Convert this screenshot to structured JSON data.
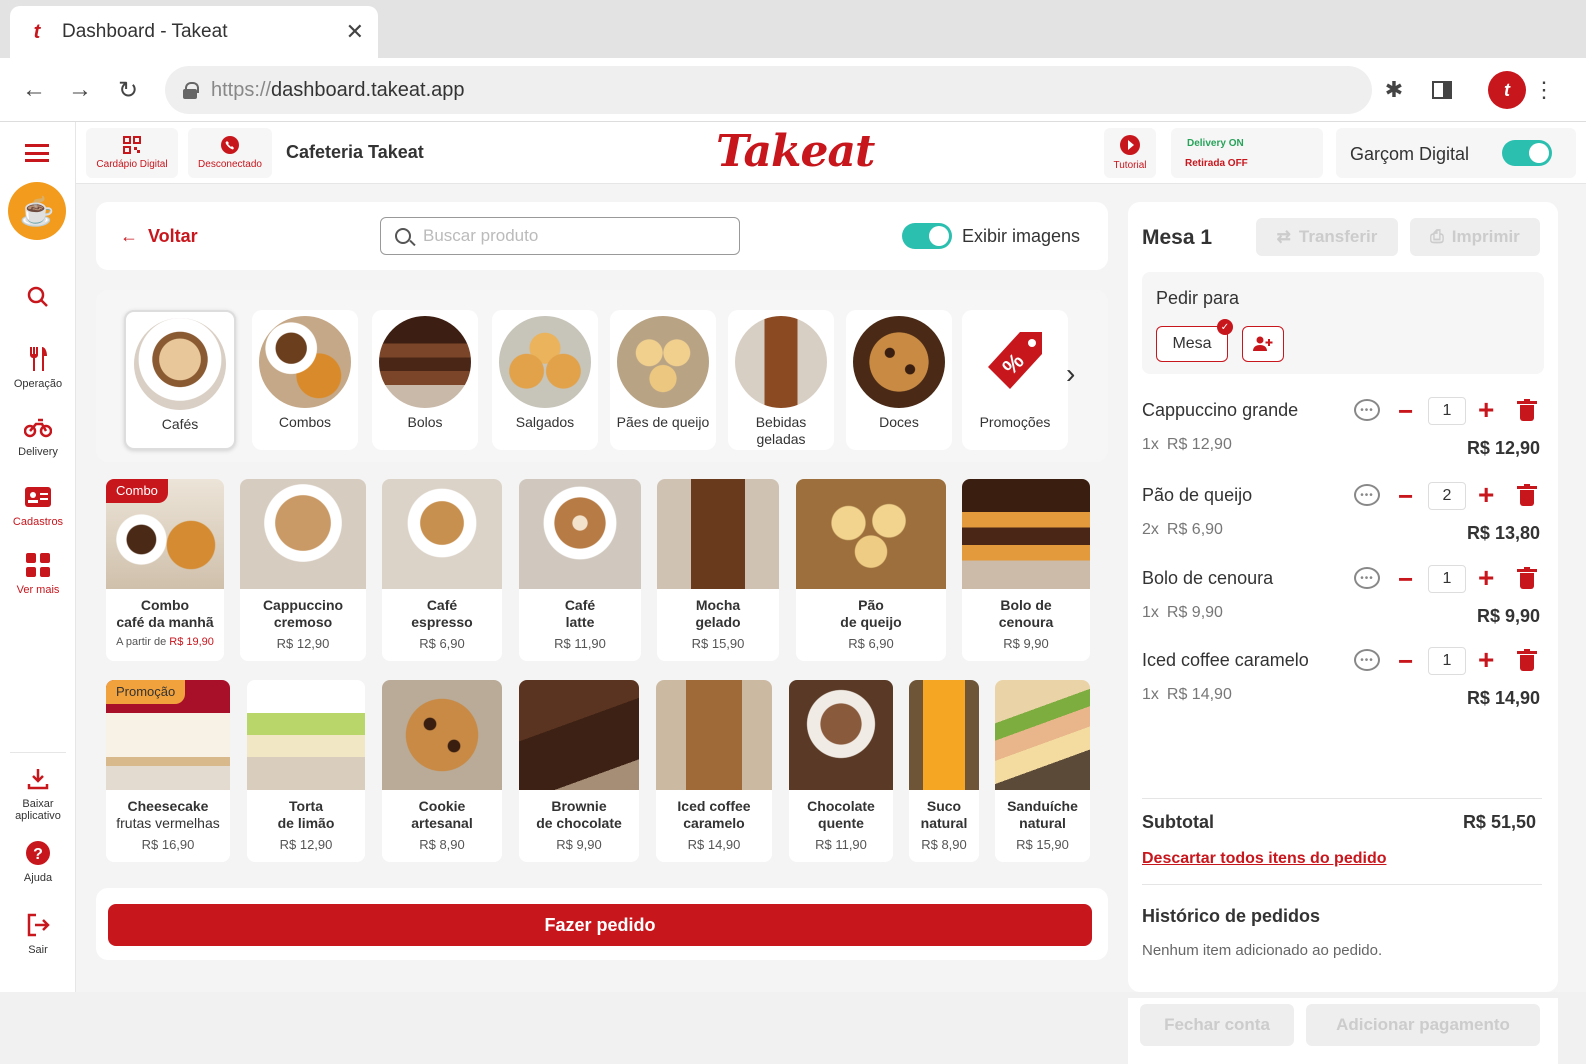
{
  "browser": {
    "tab_title": "Dashboard - Takeat",
    "url_protocol": "https://",
    "url_host": "dashboard.takeat.app"
  },
  "topbar": {
    "menu_digital": "Cardápio Digital",
    "disconnected": "Desconectado",
    "store_name": "Cafeteria Takeat",
    "brand": "Takeat",
    "tutorial": "Tutorial",
    "delivery_status": "Delivery ON",
    "pickup_status": "Retirada OFF",
    "waiter_label": "Garçom Digital"
  },
  "sidebar": {
    "items": [
      {
        "label": "Operação",
        "icon": "cutlery-icon"
      },
      {
        "label": "Delivery",
        "icon": "motorcycle-icon"
      },
      {
        "label": "Cadastros",
        "icon": "id-card-icon"
      },
      {
        "label": "Ver mais",
        "icon": "grid-icon"
      }
    ],
    "bottom": [
      {
        "label": "Baixar aplicativo",
        "icon": "download-icon"
      },
      {
        "label": "Ajuda",
        "icon": "help-icon"
      },
      {
        "label": "Sair",
        "icon": "logout-icon"
      }
    ]
  },
  "search_bar": {
    "back": "Voltar",
    "placeholder": "Buscar produto",
    "show_images_label": "Exibir imagens"
  },
  "categories": [
    "Cafés",
    "Combos",
    "Bolos",
    "Salgados",
    "Pães de queijo",
    "Bebidas geladas",
    "Doces",
    "Promoções"
  ],
  "products_row1": [
    {
      "name1": "Combo",
      "name2": "café da manhã",
      "prefix": "A partir de ",
      "price": "R$ 19,90",
      "tag": "Combo"
    },
    {
      "name1": "Cappuccino",
      "name2": "cremoso",
      "price": "R$ 12,90"
    },
    {
      "name1": "Café",
      "name2": "espresso",
      "price": "R$ 6,90"
    },
    {
      "name1": "Café",
      "name2": "latte",
      "price": "R$ 11,90"
    },
    {
      "name1": "Mocha",
      "name2": "gelado",
      "price": "R$ 15,90"
    },
    {
      "name1": "Pão",
      "name2": "de queijo",
      "price": "R$ 6,90"
    },
    {
      "name1": "Bolo de",
      "name2": "cenoura",
      "price": "R$ 9,90"
    }
  ],
  "products_row2": [
    {
      "name1": "Cheesecake",
      "name2": "frutas vermelhas",
      "price": "R$ 16,90",
      "tag": "Promoção"
    },
    {
      "name1": "Torta",
      "name2": "de limão",
      "price": "R$ 12,90"
    },
    {
      "name1": "Cookie",
      "name2": "artesanal",
      "price": "R$ 8,90"
    },
    {
      "name1": "Brownie",
      "name2": "de chocolate",
      "price": "R$ 9,90"
    },
    {
      "name1": "Iced coffee",
      "name2": "caramelo",
      "price": "R$ 14,90"
    },
    {
      "name1": "Chocolate",
      "name2": "quente",
      "price": "R$ 11,90"
    },
    {
      "name1": "Suco",
      "name2": "natural",
      "price": "R$ 8,90"
    },
    {
      "name1": "Sanduíche",
      "name2": "natural",
      "price": "R$ 15,90"
    }
  ],
  "order_button": "Fazer pedido",
  "order": {
    "table": "Mesa 1",
    "transfer": "Transferir",
    "print": "Imprimir",
    "order_for": "Pedir para",
    "table_option": "Mesa",
    "items": [
      {
        "name": "Cappuccino grande",
        "qty": "1",
        "qty_label": "1x",
        "unit": "R$ 12,90",
        "total": "R$ 12,90"
      },
      {
        "name": "Pão de queijo",
        "qty": "2",
        "qty_label": "2x",
        "unit": "R$ 6,90",
        "total": "R$ 13,80"
      },
      {
        "name": "Bolo de cenoura",
        "qty": "1",
        "qty_label": "1x",
        "unit": "R$ 9,90",
        "total": "R$ 9,90"
      },
      {
        "name": "Iced coffee caramelo",
        "qty": "1",
        "qty_label": "1x",
        "unit": "R$ 14,90",
        "total": "R$ 14,90"
      }
    ],
    "subtotal_label": "Subtotal",
    "subtotal": "R$ 51,50",
    "discard": "Descartar todos itens do pedido",
    "history_title": "Histórico de pedidos",
    "history_empty": "Nenhum item adicionado ao pedido.",
    "close_bill": "Fechar conta",
    "add_payment": "Adicionar pagamento"
  },
  "colors": {
    "brand_red": "#c8161d",
    "toggle_teal": "#2bbfb0",
    "delivery_green": "#27a35a"
  }
}
